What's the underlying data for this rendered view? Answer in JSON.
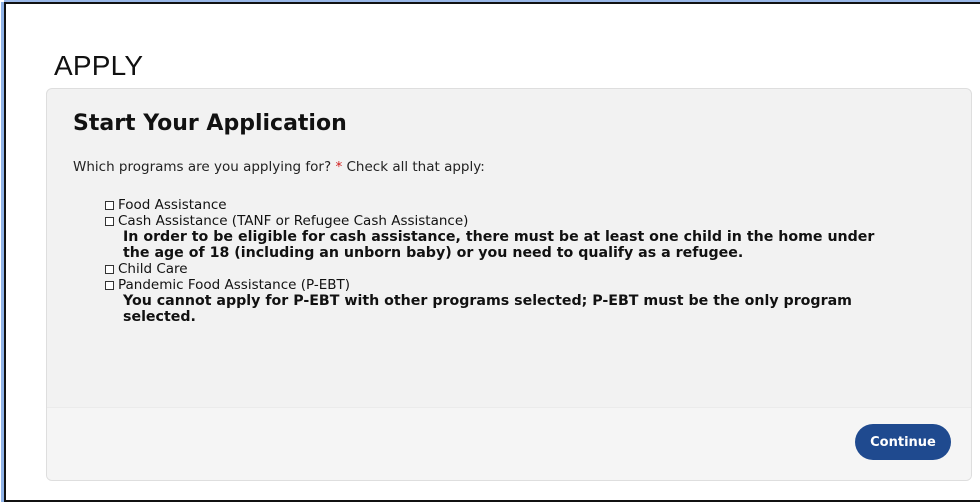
{
  "page": {
    "title": "APPLY"
  },
  "form": {
    "heading": "Start Your Application",
    "question_prefix": "Which programs are you applying for?",
    "required_marker": "*",
    "question_suffix": "Check all that apply:",
    "options": [
      {
        "label": "Food Assistance",
        "checked": false,
        "note": ""
      },
      {
        "label": "Cash Assistance (TANF or Refugee Cash Assistance)",
        "checked": false,
        "note": "In order to be eligible for cash assistance, there must be at least one child in the home under the age of 18 (including an unborn baby) or you need to qualify as a refugee."
      },
      {
        "label": "Child Care",
        "checked": false,
        "note": ""
      },
      {
        "label": "Pandemic Food Assistance (P-EBT)",
        "checked": false,
        "note": "You cannot apply for P-EBT with other programs selected; P-EBT must be the only program selected."
      }
    ],
    "continue_label": "Continue"
  },
  "colors": {
    "button": "#1f4a8f",
    "required": "#d11a1a",
    "card_background": "#f2f2f2"
  }
}
